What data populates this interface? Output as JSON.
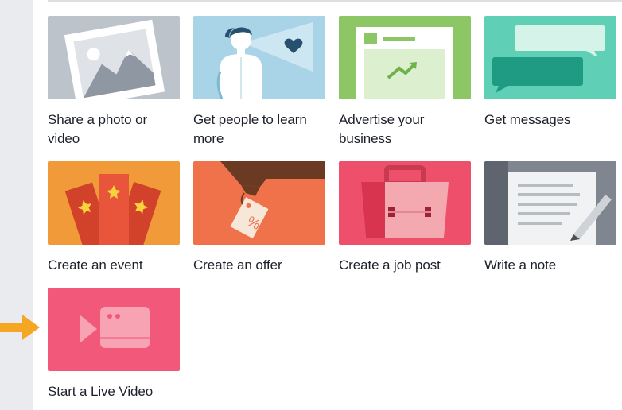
{
  "tiles": [
    {
      "label": "Share a photo or video",
      "icon": "photo-icon",
      "color": "#bcc3cb"
    },
    {
      "label": "Get people to learn more",
      "icon": "person-icon",
      "color": "#a9d3e6"
    },
    {
      "label": "Advertise your business",
      "icon": "advertise-icon",
      "color": "#8cc665"
    },
    {
      "label": "Get messages",
      "icon": "messages-icon",
      "color": "#5fd0b5"
    },
    {
      "label": "Create an event",
      "icon": "event-ticket-icon",
      "color": "#f09a3a"
    },
    {
      "label": "Create an offer",
      "icon": "offer-tag-icon",
      "color": "#f0724a"
    },
    {
      "label": "Create a job post",
      "icon": "briefcase-icon",
      "color": "#ee506c"
    },
    {
      "label": "Write a note",
      "icon": "note-icon",
      "color": "#7f8690"
    },
    {
      "label": "Start a Live Video",
      "icon": "live-video-icon",
      "color": "#f2587a"
    }
  ],
  "colors": {
    "arrow": "#f5a623",
    "text": "#1d2129",
    "page_background": "#e9ebee",
    "panel": "#ffffff"
  }
}
